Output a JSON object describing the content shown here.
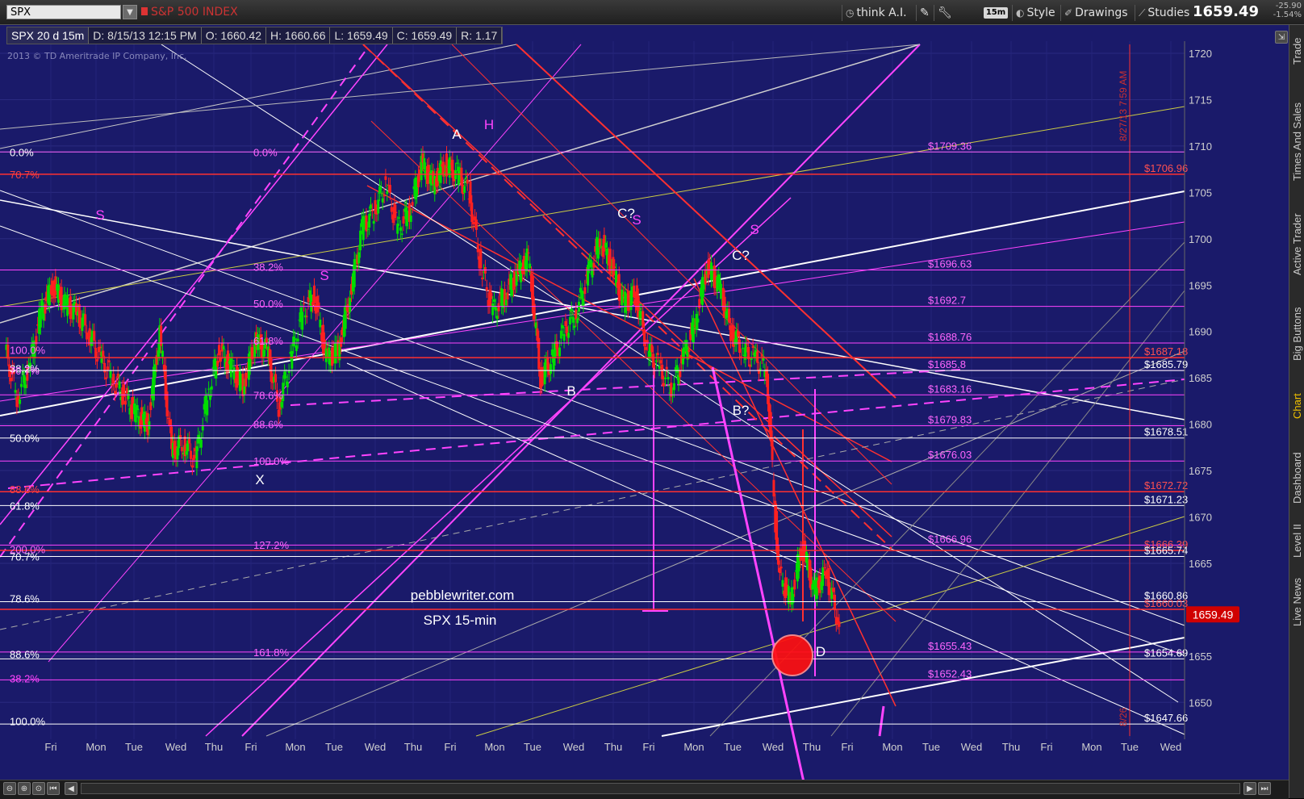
{
  "header": {
    "symbol": "SPX",
    "symbol_name": "S&P 500 INDEX",
    "think_ai": "think A.I.",
    "interval": "15m",
    "style": "Style",
    "drawings": "Drawings",
    "studies": "Studies",
    "last_price": "1659.49",
    "change": "-25.90",
    "change_pct": "-1.54%"
  },
  "infobar": {
    "symbol": "SPX 20 d 15m",
    "date": "D: 8/15/13 12:15 PM",
    "open": "O: 1660.42",
    "high": "H: 1660.66",
    "low": "L: 1659.49",
    "close": "C: 1659.49",
    "range": "R: 1.17"
  },
  "copyright": "2013 © TD Ameritrade IP Company, Inc.",
  "watermark": {
    "site": "pebblewriter.com",
    "caption": "SPX 15-min"
  },
  "right_tabs": [
    "Trade",
    "Times And Sales",
    "Active Trader",
    "Big Buttons",
    "Chart",
    "Dashboard",
    "Level II",
    "Live News"
  ],
  "active_tab": "Chart",
  "colors": {
    "background": "#1a1a6a",
    "up": "#00dd00",
    "down": "#ff2020",
    "fib": "#ff44ff",
    "pivot": "#ff3030",
    "trend": "#ffffff"
  },
  "chart_data": {
    "type": "candlestick",
    "title": "SPX 20 d 15m",
    "ylim": [
      1645,
      1722
    ],
    "y_ticks": [
      1650,
      1655,
      1660,
      1665,
      1670,
      1675,
      1680,
      1685,
      1690,
      1695,
      1700,
      1705,
      1710,
      1715,
      1720
    ],
    "x_ticks": [
      "Fri",
      "Mon",
      "Tue",
      "Wed",
      "Thu",
      "Fri",
      "Mon",
      "Tue",
      "Wed",
      "Thu",
      "Fri",
      "Mon",
      "Tue",
      "Wed",
      "Thu",
      "Fri",
      "Mon",
      "Tue",
      "Wed",
      "Thu",
      "Fri",
      "Mon",
      "Tue",
      "Wed"
    ],
    "price_path": [
      [
        0,
        1688
      ],
      [
        1,
        1683
      ],
      [
        2,
        1686
      ],
      [
        3,
        1692
      ],
      [
        4,
        1695
      ],
      [
        5,
        1693
      ],
      [
        6,
        1692
      ],
      [
        7,
        1690
      ],
      [
        8,
        1687
      ],
      [
        9,
        1685
      ],
      [
        10,
        1683
      ],
      [
        11,
        1681
      ],
      [
        12,
        1680
      ],
      [
        13,
        1690
      ],
      [
        14,
        1677
      ],
      [
        15,
        1678
      ],
      [
        16,
        1676
      ],
      [
        17,
        1683
      ],
      [
        18,
        1688
      ],
      [
        19,
        1686
      ],
      [
        20,
        1684
      ],
      [
        21,
        1689
      ],
      [
        22,
        1688
      ],
      [
        23,
        1682
      ],
      [
        24,
        1687
      ],
      [
        25,
        1692
      ],
      [
        26,
        1694
      ],
      [
        27,
        1687
      ],
      [
        28,
        1688
      ],
      [
        29,
        1694
      ],
      [
        30,
        1701
      ],
      [
        31,
        1703
      ],
      [
        32,
        1706
      ],
      [
        33,
        1701
      ],
      [
        34,
        1703
      ],
      [
        35,
        1708
      ],
      [
        36,
        1706
      ],
      [
        37,
        1708
      ],
      [
        38,
        1707
      ],
      [
        39,
        1705
      ],
      [
        40,
        1697
      ],
      [
        41,
        1692
      ],
      [
        42,
        1694
      ],
      [
        43,
        1696
      ],
      [
        44,
        1698
      ],
      [
        45,
        1685
      ],
      [
        46,
        1687
      ],
      [
        47,
        1690
      ],
      [
        48,
        1692
      ],
      [
        49,
        1696
      ],
      [
        50,
        1700
      ],
      [
        51,
        1697
      ],
      [
        52,
        1693
      ],
      [
        53,
        1694
      ],
      [
        54,
        1688
      ],
      [
        55,
        1686
      ],
      [
        56,
        1684
      ],
      [
        57,
        1687
      ],
      [
        58,
        1691
      ],
      [
        59,
        1697
      ],
      [
        60,
        1695
      ],
      [
        61,
        1690
      ],
      [
        62,
        1688
      ],
      [
        63,
        1687
      ],
      [
        64,
        1686
      ],
      [
        65,
        1664
      ],
      [
        66,
        1661
      ],
      [
        67,
        1667
      ],
      [
        68,
        1662
      ],
      [
        69,
        1664
      ],
      [
        70,
        1659
      ]
    ],
    "horizontal_levels": [
      {
        "label": "$1709.36",
        "value": 1709.36,
        "color": "#ff66ff"
      },
      {
        "label": "$1706.96",
        "value": 1706.96,
        "color": "#ff3030"
      },
      {
        "label": "$1696.63",
        "value": 1696.63,
        "color": "#ff44ff"
      },
      {
        "label": "$1692.7",
        "value": 1692.7,
        "color": "#ff44ff"
      },
      {
        "label": "$1688.76",
        "value": 1688.76,
        "color": "#ff44ff"
      },
      {
        "label": "$1687.18",
        "value": 1687.18,
        "color": "#ff3030"
      },
      {
        "label": "$1685.8",
        "value": 1685.8,
        "color": "#ff44ff"
      },
      {
        "label": "$1685.79",
        "value": 1685.79,
        "color": "#ffffff"
      },
      {
        "label": "$1683.16",
        "value": 1683.16,
        "color": "#ff44ff"
      },
      {
        "label": "$1679.83",
        "value": 1679.83,
        "color": "#ff44ff"
      },
      {
        "label": "$1678.51",
        "value": 1678.51,
        "color": "#ffffff"
      },
      {
        "label": "$1676.03",
        "value": 1676.03,
        "color": "#ff44ff"
      },
      {
        "label": "$1672.72",
        "value": 1672.72,
        "color": "#ff3030"
      },
      {
        "label": "$1671.23",
        "value": 1671.23,
        "color": "#ffffff"
      },
      {
        "label": "$1666.96",
        "value": 1666.96,
        "color": "#ff44ff"
      },
      {
        "label": "$1666.39",
        "value": 1666.39,
        "color": "#ff3030"
      },
      {
        "label": "$1665.74",
        "value": 1665.74,
        "color": "#ffffff"
      },
      {
        "label": "$1660.86",
        "value": 1660.86,
        "color": "#ffffff"
      },
      {
        "label": "$1660.03",
        "value": 1660.03,
        "color": "#ff3030"
      },
      {
        "label": "$1655.43",
        "value": 1655.43,
        "color": "#ff44ff"
      },
      {
        "label": "$1654.69",
        "value": 1654.69,
        "color": "#ffffff"
      },
      {
        "label": "$1652.43",
        "value": 1652.43,
        "color": "#ff44ff"
      },
      {
        "label": "$1647.66",
        "value": 1647.66,
        "color": "#ffffff"
      }
    ],
    "fib_labels": [
      {
        "text": "0.0%",
        "value": 1709.36,
        "color": "#ffffff"
      },
      {
        "text": "70.7%",
        "value": 1706.96,
        "color": "#ff4040"
      },
      {
        "text": "38.2%",
        "value": 1686.0,
        "color": "#ffffff"
      },
      {
        "text": "50.0%",
        "value": 1678.51,
        "color": "#ffffff"
      },
      {
        "text": "88.6%",
        "value": 1673.0,
        "color": "#ff4040"
      },
      {
        "text": "61.8%",
        "value": 1671.23,
        "color": "#ffffff"
      },
      {
        "text": "70.7%",
        "value": 1665.74,
        "color": "#ffffff"
      },
      {
        "text": "78.6%",
        "value": 1661.2,
        "color": "#ffffff"
      },
      {
        "text": "88.6%",
        "value": 1655.2,
        "color": "#ffffff"
      },
      {
        "text": "38.2%",
        "value": 1652.6,
        "color": "#ff44ff"
      },
      {
        "text": "100.0%",
        "value": 1648.0,
        "color": "#ffffff"
      },
      {
        "text": "0.0%",
        "value": 1709.36,
        "color": "#ff66ff"
      },
      {
        "text": "38.2%",
        "value": 1697.0,
        "color": "#ff66ff"
      },
      {
        "text": "50.0%",
        "value": 1693.0,
        "color": "#ff66ff"
      },
      {
        "text": "61.8%",
        "value": 1689.0,
        "color": "#ff66ff"
      },
      {
        "text": "78.6%",
        "value": 1683.16,
        "color": "#ff66ff"
      },
      {
        "text": "88.6%",
        "value": 1680.0,
        "color": "#ff66ff"
      },
      {
        "text": "100.0%",
        "value": 1676.03,
        "color": "#ff66ff"
      },
      {
        "text": "127.2%",
        "value": 1667.0,
        "color": "#ff66ff"
      },
      {
        "text": "161.8%",
        "value": 1655.43,
        "color": "#ff66ff"
      },
      {
        "text": "200.0%",
        "value": 1666.5,
        "color": "#ff66ff"
      },
      {
        "text": "100.0%",
        "value": 1688.0,
        "color": "#ff66ff"
      },
      {
        "text": "70.7%",
        "value": 1685.8,
        "color": "#ff66ff"
      }
    ],
    "annotations": [
      {
        "text": "A",
        "color": "#ffffff"
      },
      {
        "text": "H",
        "color": "#ff44ff"
      },
      {
        "text": "S",
        "color": "#ff44ff"
      },
      {
        "text": "S",
        "color": "#ff44ff"
      },
      {
        "text": "S",
        "color": "#ff44ff"
      },
      {
        "text": "S",
        "color": "#ff44ff"
      },
      {
        "text": "C?",
        "color": "#ffffff"
      },
      {
        "text": "C?",
        "color": "#ffffff"
      },
      {
        "text": "B",
        "color": "#ffffff"
      },
      {
        "text": "B?",
        "color": "#ffffff"
      },
      {
        "text": "X",
        "color": "#ffffff"
      },
      {
        "text": "D",
        "color": "#ffffff"
      }
    ],
    "vertical_marker": "8/27/13 7:59 AM",
    "vertical_marker_bottom": "8/26"
  }
}
